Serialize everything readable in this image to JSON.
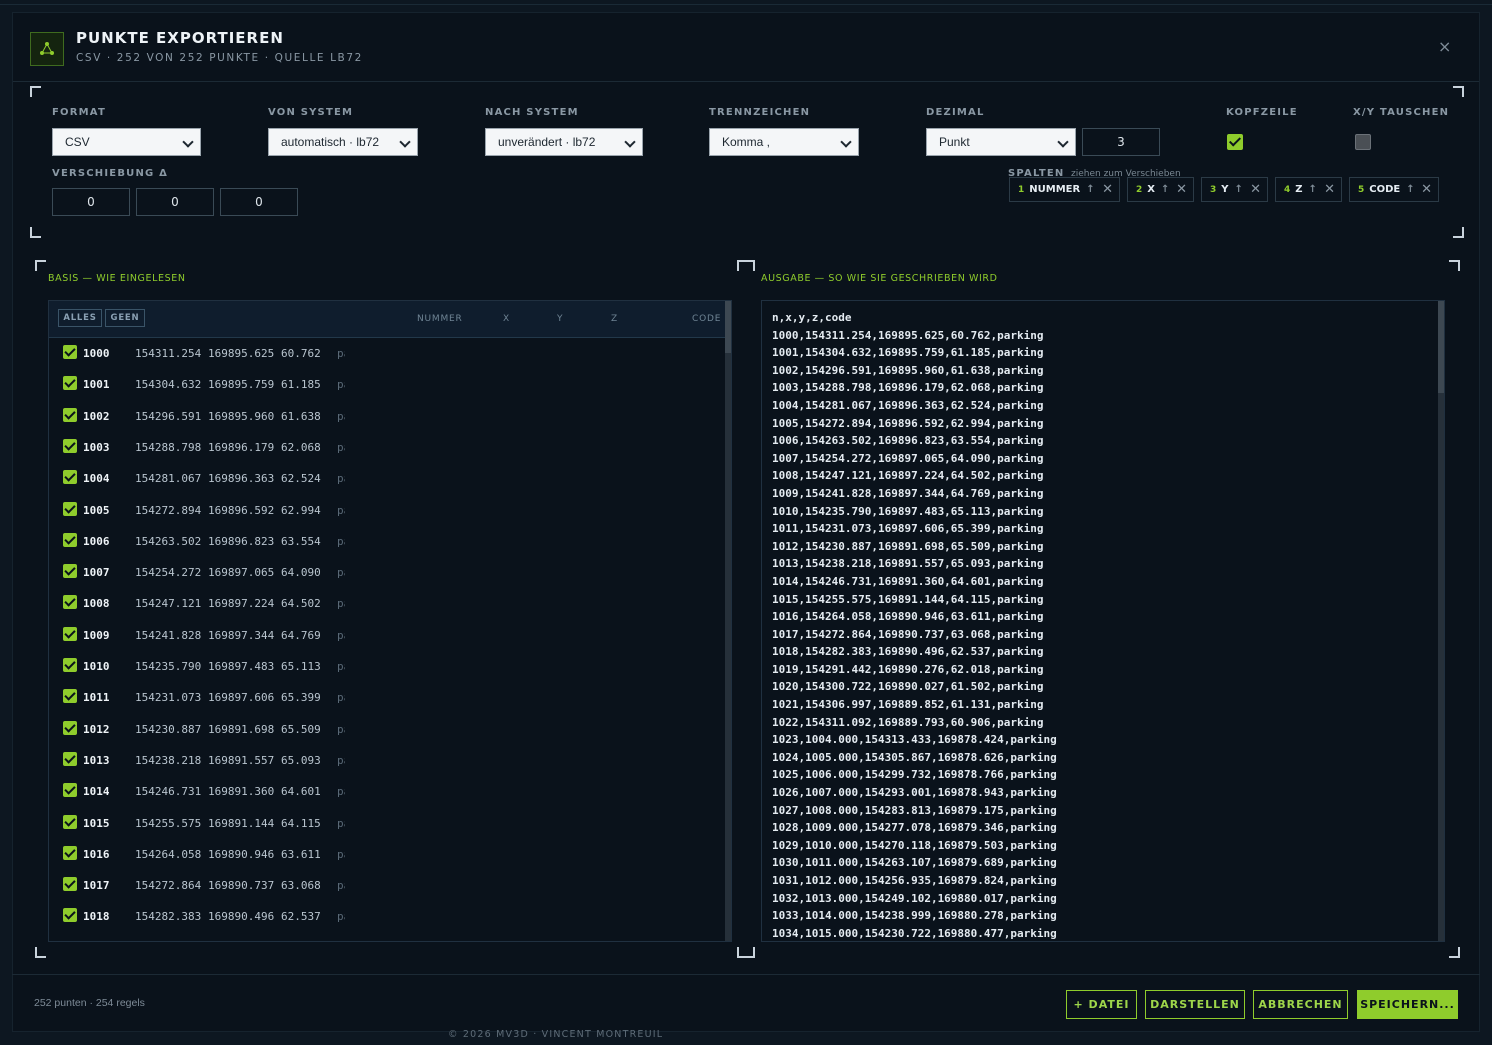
{
  "dialog": {
    "title": "PUNKTE EXPORTIEREN",
    "subtitle": "CSV · 252 VON 252 PUNKTE · QUELLE LB72",
    "close_label": "×"
  },
  "settings": {
    "format": {
      "label": "FORMAT",
      "value": "CSV"
    },
    "von_system": {
      "label": "VON SYSTEM",
      "value": "automatisch · lb72"
    },
    "nach_system": {
      "label": "NACH SYSTEM",
      "value": "unverändert · lb72"
    },
    "trennzeichen": {
      "label": "TRENNZEICHEN",
      "value": "Komma ,"
    },
    "dezimal": {
      "label": "DEZIMAL",
      "value": "Punkt",
      "precision": "3"
    },
    "kopfzeile": {
      "label": "KOPFZEILE",
      "checked": true
    },
    "xy_tauschen": {
      "label": "X/Y TAUSCHEN",
      "checked": false
    },
    "verschiebung": {
      "label": "VERSCHIEBUNG Δ",
      "values": [
        "0",
        "0",
        "0"
      ]
    },
    "spalten": {
      "label": "SPALTEN",
      "hint": "ziehen zum Verschieben",
      "columns": [
        {
          "index": "1",
          "name": "NUMMER",
          "arrow": "↑"
        },
        {
          "index": "2",
          "name": "X",
          "arrow": "↑"
        },
        {
          "index": "3",
          "name": "Y",
          "arrow": "↑"
        },
        {
          "index": "4",
          "name": "Z",
          "arrow": "↑"
        },
        {
          "index": "5",
          "name": "CODE",
          "arrow": "↑"
        }
      ]
    }
  },
  "basis": {
    "title": "BASIS — WIE EINGELESEN",
    "btn_all": "ALLES",
    "btn_none": "GEEN",
    "headers": {
      "nummer": "NUMMER",
      "x": "X",
      "y": "Y",
      "z": "Z",
      "code": "CODE"
    },
    "rows": [
      {
        "n": "1000",
        "x": "154311.254",
        "y": "169895.625",
        "z": "60.762",
        "c": "parking"
      },
      {
        "n": "1001",
        "x": "154304.632",
        "y": "169895.759",
        "z": "61.185",
        "c": "parking"
      },
      {
        "n": "1002",
        "x": "154296.591",
        "y": "169895.960",
        "z": "61.638",
        "c": "parking"
      },
      {
        "n": "1003",
        "x": "154288.798",
        "y": "169896.179",
        "z": "62.068",
        "c": "parking"
      },
      {
        "n": "1004",
        "x": "154281.067",
        "y": "169896.363",
        "z": "62.524",
        "c": "parking"
      },
      {
        "n": "1005",
        "x": "154272.894",
        "y": "169896.592",
        "z": "62.994",
        "c": "parking"
      },
      {
        "n": "1006",
        "x": "154263.502",
        "y": "169896.823",
        "z": "63.554",
        "c": "parking"
      },
      {
        "n": "1007",
        "x": "154254.272",
        "y": "169897.065",
        "z": "64.090",
        "c": "parking"
      },
      {
        "n": "1008",
        "x": "154247.121",
        "y": "169897.224",
        "z": "64.502",
        "c": "parking"
      },
      {
        "n": "1009",
        "x": "154241.828",
        "y": "169897.344",
        "z": "64.769",
        "c": "parking"
      },
      {
        "n": "1010",
        "x": "154235.790",
        "y": "169897.483",
        "z": "65.113",
        "c": "parking"
      },
      {
        "n": "1011",
        "x": "154231.073",
        "y": "169897.606",
        "z": "65.399",
        "c": "parking"
      },
      {
        "n": "1012",
        "x": "154230.887",
        "y": "169891.698",
        "z": "65.509",
        "c": "parking"
      },
      {
        "n": "1013",
        "x": "154238.218",
        "y": "169891.557",
        "z": "65.093",
        "c": "parking"
      },
      {
        "n": "1014",
        "x": "154246.731",
        "y": "169891.360",
        "z": "64.601",
        "c": "parking"
      },
      {
        "n": "1015",
        "x": "154255.575",
        "y": "169891.144",
        "z": "64.115",
        "c": "parking"
      },
      {
        "n": "1016",
        "x": "154264.058",
        "y": "169890.946",
        "z": "63.611",
        "c": "parking"
      },
      {
        "n": "1017",
        "x": "154272.864",
        "y": "169890.737",
        "z": "63.068",
        "c": "parking"
      },
      {
        "n": "1018",
        "x": "154282.383",
        "y": "169890.496",
        "z": "62.537",
        "c": "parking"
      }
    ]
  },
  "ausgabe": {
    "title": "AUSGABE — SO WIE SIE GESCHRIEBEN WIRD",
    "lines": [
      "n,x,y,z,code",
      "1000,154311.254,169895.625,60.762,parking",
      "1001,154304.632,169895.759,61.185,parking",
      "1002,154296.591,169895.960,61.638,parking",
      "1003,154288.798,169896.179,62.068,parking",
      "1004,154281.067,169896.363,62.524,parking",
      "1005,154272.894,169896.592,62.994,parking",
      "1006,154263.502,169896.823,63.554,parking",
      "1007,154254.272,169897.065,64.090,parking",
      "1008,154247.121,169897.224,64.502,parking",
      "1009,154241.828,169897.344,64.769,parking",
      "1010,154235.790,169897.483,65.113,parking",
      "1011,154231.073,169897.606,65.399,parking",
      "1012,154230.887,169891.698,65.509,parking",
      "1013,154238.218,169891.557,65.093,parking",
      "1014,154246.731,169891.360,64.601,parking",
      "1015,154255.575,169891.144,64.115,parking",
      "1016,154264.058,169890.946,63.611,parking",
      "1017,154272.864,169890.737,63.068,parking",
      "1018,154282.383,169890.496,62.537,parking",
      "1019,154291.442,169890.276,62.018,parking",
      "1020,154300.722,169890.027,61.502,parking",
      "1021,154306.997,169889.852,61.131,parking",
      "1022,154311.092,169889.793,60.906,parking",
      "1023,1004.000,154313.433,169878.424,parking",
      "1024,1005.000,154305.867,169878.626,parking",
      "1025,1006.000,154299.732,169878.766,parking",
      "1026,1007.000,154293.001,169878.943,parking",
      "1027,1008.000,154283.813,169879.175,parking",
      "1028,1009.000,154277.078,169879.346,parking",
      "1029,1010.000,154270.118,169879.503,parking",
      "1030,1011.000,154263.107,169879.689,parking",
      "1031,1012.000,154256.935,169879.824,parking",
      "1032,1013.000,154249.102,169880.017,parking",
      "1033,1014.000,154238.999,169880.278,parking",
      "1034,1015.000,154230.722,169880.477,parking"
    ]
  },
  "footer": {
    "count": "252 punten · 254 regels",
    "btn_datei": "+ DATEI",
    "btn_darstellen": "DARSTELLEN",
    "btn_abbrechen": "ABBRECHEN",
    "btn_speichern": "SPEICHERN..."
  },
  "copyright": "© 2026 MV3D · VINCENT MONTREUIL",
  "colors": {
    "accent": "#8fcc2c",
    "background": "#0a121b"
  }
}
